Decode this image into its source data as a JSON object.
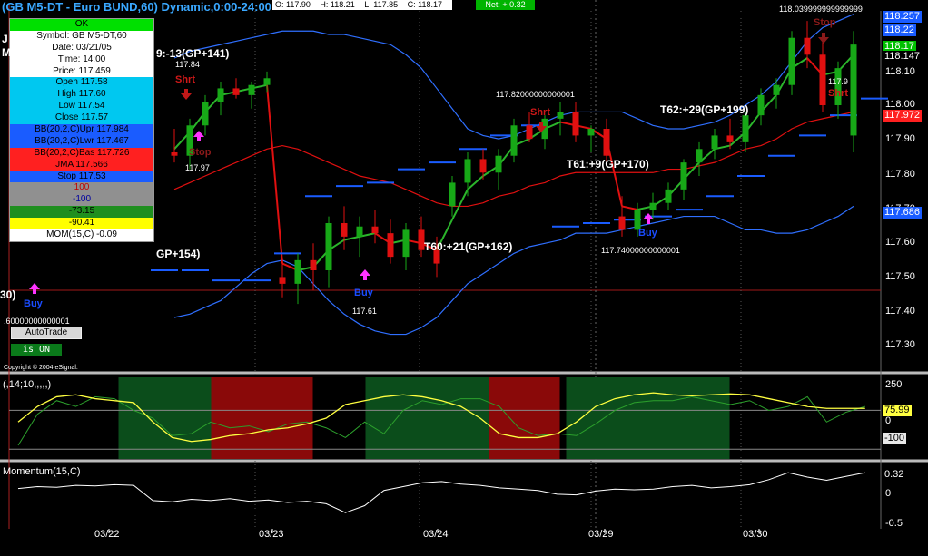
{
  "header": {
    "title": "(GB M5-DT - Euro BUND,60) Dynamic,0:00-24:00",
    "open": "O: 117.90",
    "high": "H: 118.21",
    "low": "L: 117.85",
    "close": "C: 118.17",
    "net": "Net: + 0.32"
  },
  "info_panel": {
    "ok": "OK",
    "symbol": "Symbol: GB M5-DT,60",
    "date": "Date: 03/21/05",
    "time": "Time: 14:00",
    "price": "Price: 117.459",
    "open": "Open 117.58",
    "high": "High 117.60",
    "low": "Low 117.54",
    "close": "Close 117.57",
    "bb_upr": "BB(20,2,C)Upr 117.984",
    "bb_lwr": "BB(20,2,C)Lwr 117.467",
    "bb_bas": "BB(20,2,C)Bas 117.726",
    "jma": "JMA 117.566",
    "stop": "Stop 117.53",
    "v100": "100",
    "vm100": "-100",
    "vm73": "-73.15",
    "vm90": "-90.41",
    "mom": "MOM(15,C) -0.09",
    "colors": {
      "ok": "#00e000",
      "blue": "#1a5cff",
      "cyan": "#00c8f0",
      "red": "#ff2020",
      "grey": "#909090",
      "green": "#1f8f1f",
      "yellow": "#ffff00",
      "white": "#ffffff"
    }
  },
  "controls": {
    "autotrade": "AutoTrade",
    "is_on": "is ON"
  },
  "copyright": "Copyright © 2004 eSignal.",
  "price_axis": {
    "labels": [
      "118.10",
      "118.00",
      "117.90",
      "117.80",
      "117.70",
      "117.60",
      "117.50",
      "117.40",
      "117.30"
    ],
    "tags": [
      {
        "text": "118.257",
        "color": "#1a5cff",
        "text_color": "#ffffff"
      },
      {
        "text": "118.22",
        "color": "#1a5cff",
        "text_color": "#ffffff"
      },
      {
        "text": "118.17",
        "color": "#00c000",
        "text_color": "#ffffff"
      },
      {
        "text": "118.147",
        "color": "#000000",
        "text_color": "#ffffff"
      },
      {
        "text": "117.972",
        "color": "#ff2020",
        "text_color": "#ffffff"
      },
      {
        "text": "117.686",
        "color": "#1a5cff",
        "text_color": "#ffffff"
      }
    ],
    "top_value": "118.039999999999999"
  },
  "annotations": {
    "trades": [
      {
        "text": "9:-13(GP+141)"
      },
      {
        "text": "GP+154)"
      },
      {
        "text": "T60:+21(GP+162)"
      },
      {
        "text": "T61:+9(GP+170)"
      },
      {
        "text": "T62:+29(GP+199)"
      }
    ],
    "prices": [
      "117.84",
      "117.97",
      "117.61",
      "117.82000000000001",
      "117.74000000000001",
      ".60000000000001",
      "117.9"
    ],
    "signals": [
      {
        "text": "Shrt",
        "color": "#d01818"
      },
      {
        "text": "Stop",
        "color": "#8b1a1a"
      },
      {
        "text": "Buy",
        "color": "#1a4cff"
      },
      {
        "text": "Buy",
        "color": "#1a4cff"
      },
      {
        "text": "Shrt",
        "color": "#d01818"
      },
      {
        "text": "Buy",
        "color": "#1a4cff"
      },
      {
        "text": "Stop",
        "color": "#8b1a1a"
      },
      {
        "text": "Shrt",
        "color": "#d01818"
      }
    ],
    "partial_left": [
      "J",
      "M",
      "30)"
    ]
  },
  "indicator1": {
    "label": "(,14;10,,,,,)",
    "axis": [
      "250",
      "0",
      "-100"
    ],
    "tag": "75.99"
  },
  "indicator2": {
    "label": "Momentum(15,C)",
    "axis": [
      "0",
      "-0.5"
    ],
    "tag": "0.32"
  },
  "dates": [
    "03/22",
    "03/23",
    "03/24",
    "03/29",
    "03/30"
  ],
  "chart_data": {
    "type": "candlestick",
    "title": "(GB M5-DT - Euro BUND,60) Dynamic,0:00-24:00",
    "ylim": [
      117.22,
      118.27
    ],
    "colors": {
      "up": "#17a817",
      "down": "#e01010",
      "bb": "#2f6fff",
      "bbmid": "#e01010",
      "jma_up": "#2bb52b",
      "jma_down": "#e01010",
      "stop": "#1a5cff",
      "osc": "#ffff40",
      "osc2": "#2ca02c",
      "mom": "#ffffff"
    },
    "candles": [
      [
        117.85,
        117.92,
        117.82,
        117.84
      ],
      [
        117.84,
        117.95,
        117.8,
        117.93
      ],
      [
        117.93,
        118.02,
        117.9,
        118.0
      ],
      [
        118.0,
        118.06,
        117.96,
        118.04
      ],
      [
        118.04,
        118.07,
        118.01,
        118.02
      ],
      [
        118.02,
        118.06,
        117.98,
        118.05
      ],
      [
        118.05,
        118.09,
        118.03,
        118.07
      ],
      [
        117.48,
        117.52,
        117.42,
        117.46
      ],
      [
        117.46,
        117.55,
        117.4,
        117.53
      ],
      [
        117.53,
        117.58,
        117.44,
        117.5
      ],
      [
        117.5,
        117.66,
        117.45,
        117.64
      ],
      [
        117.64,
        117.69,
        117.56,
        117.6
      ],
      [
        117.6,
        117.66,
        117.54,
        117.63
      ],
      [
        117.63,
        117.68,
        117.58,
        117.61
      ],
      [
        117.61,
        117.65,
        117.52,
        117.54
      ],
      [
        117.54,
        117.64,
        117.5,
        117.62
      ],
      [
        117.62,
        117.66,
        117.54,
        117.56
      ],
      [
        117.56,
        117.6,
        117.48,
        117.52
      ],
      [
        117.69,
        117.78,
        117.66,
        117.76
      ],
      [
        117.76,
        117.85,
        117.72,
        117.83
      ],
      [
        117.83,
        117.86,
        117.77,
        117.79
      ],
      [
        117.79,
        117.86,
        117.74,
        117.84
      ],
      [
        117.84,
        117.95,
        117.82,
        117.93
      ],
      [
        117.93,
        117.97,
        117.88,
        117.89
      ],
      [
        117.89,
        117.96,
        117.86,
        117.95
      ],
      [
        117.95,
        118.0,
        117.9,
        117.97
      ],
      [
        117.97,
        118.0,
        117.88,
        117.9
      ],
      [
        117.9,
        117.93,
        117.85,
        117.92
      ],
      [
        117.92,
        117.95,
        117.82,
        117.84
      ],
      [
        117.66,
        117.72,
        117.6,
        117.62
      ],
      [
        117.62,
        117.7,
        117.6,
        117.68
      ],
      [
        117.68,
        117.73,
        117.65,
        117.7
      ],
      [
        117.7,
        117.76,
        117.68,
        117.74
      ],
      [
        117.74,
        117.83,
        117.71,
        117.82
      ],
      [
        117.82,
        117.88,
        117.78,
        117.86
      ],
      [
        117.86,
        117.92,
        117.83,
        117.9
      ],
      [
        117.9,
        117.95,
        117.86,
        117.88
      ],
      [
        117.88,
        117.97,
        117.85,
        117.96
      ],
      [
        117.96,
        118.04,
        117.93,
        118.02
      ],
      [
        118.02,
        118.07,
        117.98,
        118.05
      ],
      [
        118.05,
        118.21,
        118.02,
        118.19
      ],
      [
        118.19,
        118.24,
        118.1,
        118.14
      ],
      [
        118.14,
        118.18,
        117.97,
        117.99
      ],
      [
        117.99,
        118.12,
        117.95,
        118.1
      ],
      [
        117.9,
        118.21,
        117.85,
        118.17
      ]
    ],
    "bb_upper": [
      118.13,
      118.15,
      118.16,
      118.17,
      118.18,
      118.19,
      118.2,
      118.21,
      118.21,
      118.21,
      118.2,
      118.2,
      118.19,
      118.18,
      118.17,
      118.14,
      118.1,
      118.04,
      117.98,
      117.92,
      117.9,
      117.89,
      117.9,
      117.92,
      117.94,
      117.96,
      117.97,
      117.97,
      117.97,
      117.97,
      117.95,
      117.93,
      117.92,
      117.92,
      117.93,
      117.94,
      117.96,
      117.99,
      118.02,
      118.06,
      118.12,
      118.18,
      118.22,
      118.24,
      118.26
    ],
    "bb_mid": [
      117.74,
      117.76,
      117.78,
      117.8,
      117.82,
      117.84,
      117.86,
      117.87,
      117.86,
      117.84,
      117.82,
      117.8,
      117.78,
      117.77,
      117.76,
      117.74,
      117.72,
      117.7,
      117.69,
      117.69,
      117.7,
      117.72,
      117.73,
      117.75,
      117.76,
      117.78,
      117.79,
      117.79,
      117.79,
      117.79,
      117.79,
      117.79,
      117.8,
      117.8,
      117.81,
      117.82,
      117.84,
      117.86,
      117.87,
      117.89,
      117.92,
      117.94,
      117.95,
      117.96,
      117.97
    ],
    "bb_lower": [
      117.36,
      117.37,
      117.39,
      117.41,
      117.45,
      117.49,
      117.52,
      117.53,
      117.51,
      117.46,
      117.41,
      117.37,
      117.34,
      117.32,
      117.31,
      117.31,
      117.33,
      117.36,
      117.41,
      117.46,
      117.49,
      117.52,
      117.55,
      117.57,
      117.58,
      117.59,
      117.61,
      117.61,
      117.61,
      117.62,
      117.63,
      117.64,
      117.65,
      117.66,
      117.66,
      117.66,
      117.64,
      117.62,
      117.62,
      117.61,
      117.61,
      117.62,
      117.64,
      117.66,
      117.69
    ],
    "jma": [
      117.86,
      117.91,
      117.97,
      118.02,
      118.03,
      118.04,
      118.05,
      117.52,
      117.5,
      117.51,
      117.56,
      117.59,
      117.6,
      117.61,
      117.58,
      117.59,
      117.58,
      117.56,
      117.65,
      117.74,
      117.78,
      117.81,
      117.87,
      117.89,
      117.92,
      117.94,
      117.93,
      117.92,
      117.89,
      117.69,
      117.68,
      117.69,
      117.72,
      117.77,
      117.82,
      117.86,
      117.87,
      117.91,
      117.97,
      118.02,
      118.1,
      118.13,
      118.08,
      118.09,
      118.14
    ],
    "stops": [
      117.78,
      117.79,
      117.8,
      117.81,
      117.5,
      117.5,
      117.47,
      117.47,
      117.55,
      117.72,
      117.75,
      117.76,
      117.8,
      117.82,
      117.86,
      117.9,
      117.93,
      117.63,
      117.64,
      117.65,
      117.66,
      117.68,
      117.72,
      117.78,
      117.84,
      117.9,
      117.96,
      118.01
    ],
    "osc": [
      40,
      120,
      170,
      180,
      160,
      150,
      140,
      40,
      -40,
      -60,
      -50,
      -30,
      -20,
      0,
      10,
      30,
      60,
      130,
      150,
      170,
      180,
      170,
      150,
      120,
      60,
      -20,
      -40,
      -40,
      -20,
      40,
      120,
      160,
      180,
      190,
      180,
      175,
      180,
      185,
      180,
      160,
      140,
      120,
      110,
      110,
      110
    ],
    "osc_green": [
      -80,
      80,
      150,
      120,
      170,
      160,
      100,
      60,
      -30,
      -20,
      40,
      10,
      20,
      -10,
      30,
      40,
      10,
      -40,
      40,
      -20,
      100,
      150,
      130,
      160,
      160,
      120,
      10,
      -30,
      -20,
      -30,
      30,
      100,
      140,
      150,
      150,
      170,
      150,
      130,
      150,
      100,
      120,
      170,
      40,
      90,
      120
    ],
    "mom": [
      0.07,
      0.1,
      0.09,
      0.12,
      0.11,
      0.13,
      0.12,
      -0.12,
      -0.14,
      -0.1,
      -0.12,
      -0.09,
      -0.13,
      -0.11,
      -0.15,
      -0.13,
      -0.17,
      -0.31,
      -0.2,
      0.04,
      0.1,
      0.16,
      0.18,
      0.14,
      0.12,
      0.08,
      0.06,
      0.04,
      -0.02,
      -0.03,
      0.03,
      0.06,
      0.05,
      0.06,
      0.1,
      0.12,
      0.08,
      0.1,
      0.13,
      0.21,
      0.32,
      0.25,
      0.2,
      0.26,
      0.32
    ],
    "osc_zones": [
      {
        "from": 1,
        "to": 6,
        "color": "#0b4d1b"
      },
      {
        "from": 7,
        "to": 12,
        "color": "#8a0909"
      },
      {
        "from": 17,
        "to": 24,
        "color": "#0b4d1b"
      },
      {
        "from": 25,
        "to": 28,
        "color": "#8a0909"
      },
      {
        "from": 30,
        "to": 39,
        "color": "#0b4d1b"
      }
    ]
  }
}
